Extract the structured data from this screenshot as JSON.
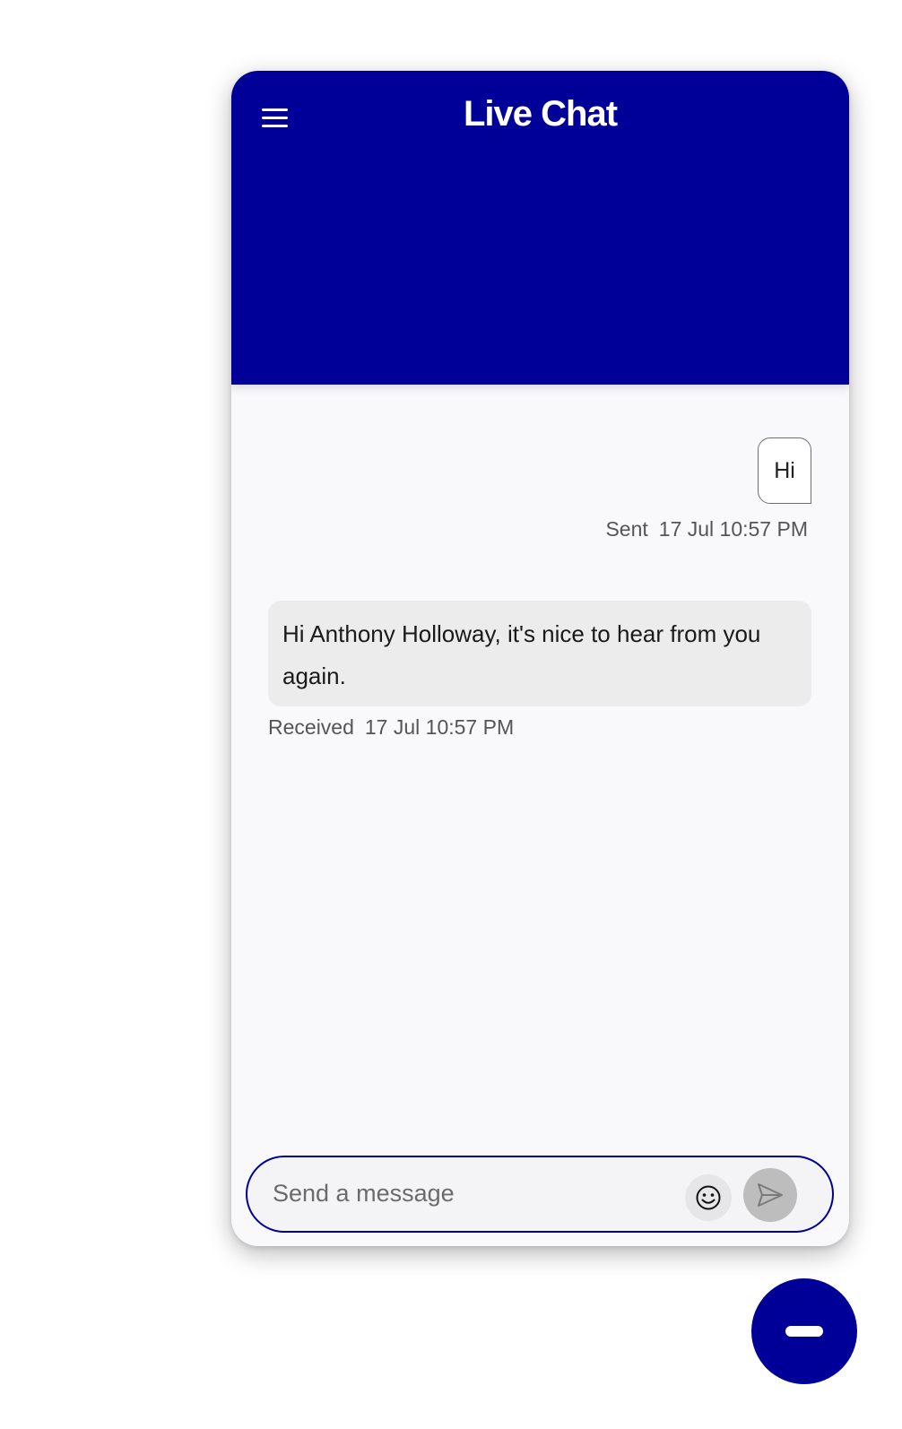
{
  "header": {
    "title": "Live Chat",
    "color": "#000099"
  },
  "messages": [
    {
      "direction": "sent",
      "text": "Hi",
      "status": "Sent",
      "timestamp": "17 Jul 10:57 PM"
    },
    {
      "direction": "received",
      "text": "Hi Anthony Holloway, it's nice to hear from you again.",
      "status": "Received",
      "timestamp": "17 Jul 10:57 PM"
    }
  ],
  "composer": {
    "placeholder": "Send a message",
    "value": "",
    "emoji_icon": "smiley-icon",
    "send_icon": "paper-plane-icon"
  },
  "fab": {
    "icon": "minimize-icon"
  },
  "colors": {
    "brand": "#000099",
    "received_bubble": "#ececec",
    "send_button_disabled": "#bdbdbd"
  }
}
